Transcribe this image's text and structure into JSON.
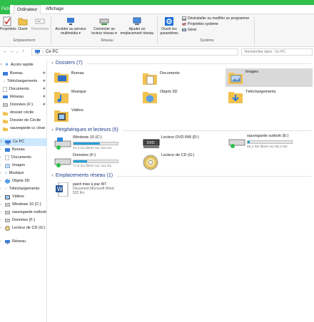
{
  "ribbon_tabs": [
    "Fichier",
    "Ordinateur",
    "Affichage"
  ],
  "ribbon": {
    "properties": "Propriétés",
    "open": "Ouvrir",
    "rename": "Renommer",
    "access_media_1": "Accéder au serveur",
    "access_media_2": "multimédia ▾",
    "map_drive_1": "Connecter un",
    "map_drive_2": "lecteur réseau ▾",
    "add_location_1": "Ajouter un",
    "add_location_2": "emplacement réseau",
    "open_settings_1": "Ouvrir les",
    "open_settings_2": "paramètres",
    "uninstall": "Désinstaller ou modifier un programme",
    "system_props": "Propriétés système",
    "manage": "Gérer",
    "group_location": "Emplacement",
    "group_network": "Réseau",
    "group_system": "Système"
  },
  "address": {
    "path": "Ce PC",
    "search_placeholder": "Rechercher dans : Ce PC"
  },
  "sidebar": {
    "quick_access": "Accès rapide",
    "items": [
      "Bureau",
      "Téléchargements",
      "Documents",
      "Réseau",
      "Données (F:)",
      "dossier cécile",
      "Dossier de Cécile",
      "sauvegarde cc clear",
      "Ce PC",
      "Bureau",
      "Documents",
      "Images",
      "Musique",
      "Objets 3D",
      "Téléchargements",
      "Vidéos",
      "Windows 10 (C:)",
      "sauvegarde outlook",
      "Données (F:)",
      "Lecteur de CD (G:)",
      "Réseau"
    ]
  },
  "folders_section": "Dossiers (7)",
  "folders": [
    "Bureau",
    "Documents",
    "Images",
    "Musique",
    "Objets 3D",
    "Téléchargements",
    "Vidéos"
  ],
  "drives_section": "Périphériques et lecteurs (5)",
  "drives": [
    {
      "name": "Windows 10 (C:)",
      "free": "44,4 Go libres sur 110 Go",
      "used_fraction": 0.6
    },
    {
      "name": "Lecteur DVD RW (D:)"
    },
    {
      "name": "sauvegarde outlook (E:)",
      "free": "88,2 Mo libres sur 88,2 Mo",
      "used_fraction": 0.05
    },
    {
      "name": "Données (F:)",
      "free": "77,6 Go libres sur 111 Go",
      "used_fraction": 0.3
    },
    {
      "name": "Lecteur de CD (G:)"
    }
  ],
  "network_section": "Emplacements réseau (1)",
  "network_item": {
    "name": "patch mise à jour W7",
    "type": "Document Microsoft Word",
    "size": "522 Ko"
  },
  "colors": {
    "accent": "#2fbf4a",
    "selection": "#cce8ff",
    "bar": "#26a0da"
  }
}
